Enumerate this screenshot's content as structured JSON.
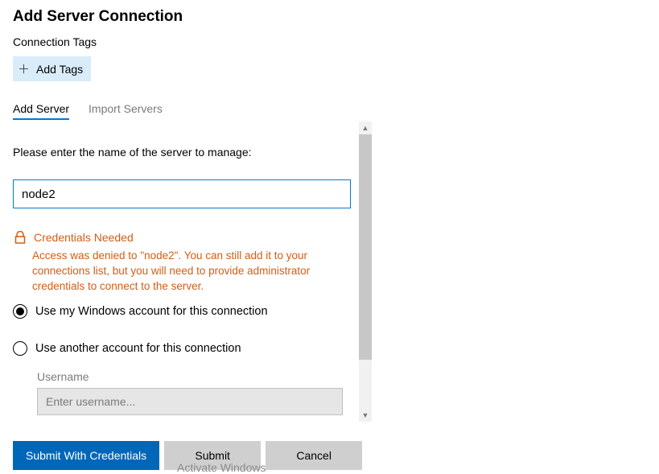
{
  "header": {
    "title": "Add Server Connection",
    "tags_label": "Connection Tags",
    "add_tags_label": "Add Tags"
  },
  "tabs": {
    "add_server": "Add Server",
    "import_servers": "Import Servers"
  },
  "form": {
    "prompt": "Please enter the name of the server to manage:",
    "server_value": "node2",
    "warning": {
      "title": "Credentials Needed",
      "body": "Access was denied to \"node2\". You can still add it to your connections list, but you will need to provide administrator credentials to connect to the server."
    },
    "radio_windows": "Use my Windows account for this connection",
    "radio_other": "Use another account for this connection",
    "username_label": "Username",
    "username_placeholder": "Enter username..."
  },
  "buttons": {
    "submit_creds": "Submit With Credentials",
    "submit": "Submit",
    "cancel": "Cancel"
  },
  "watermark": "Activate Windows",
  "colors": {
    "accent": "#0078d4",
    "warning": "#d25d17",
    "button_primary": "#0067b8"
  }
}
